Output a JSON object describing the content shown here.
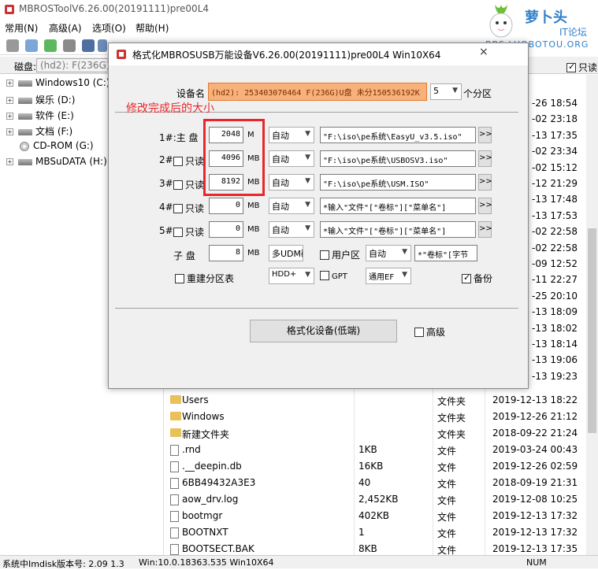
{
  "app": {
    "title": "MBROSToolV6.26.00(20191111)pre00L4",
    "menus": [
      "常用(N)",
      "高级(A)",
      "选项(O)",
      "帮助(H)"
    ],
    "disk_label": "磁盘:",
    "disk_value": "(hd2): F(236G)USB",
    "readonly_label": "只读"
  },
  "logo": {
    "brand": "萝卜头",
    "sub": "IT论坛",
    "url": "BBS.LUOBOTOU.ORG"
  },
  "tree": [
    {
      "label": "Windows10 (C:)",
      "type": "drive"
    },
    {
      "label": "娱乐 (D:)",
      "type": "drive"
    },
    {
      "label": "软件 (E:)",
      "type": "drive"
    },
    {
      "label": "文档 (F:)",
      "type": "drive"
    },
    {
      "label": "CD-ROM (G:)",
      "type": "cdrom"
    },
    {
      "label": "MBSuDATA (H:)",
      "type": "drive"
    }
  ],
  "file_dates_visible": [
    "-26 18:54",
    "-02 23:18",
    "-13 17:35",
    "-02 23:34",
    "-02 15:12",
    "-12 21:29",
    "-13 17:48",
    "-13 17:53",
    "-02 22:58",
    "-02 22:58",
    "-09 12:52",
    "-11 22:27",
    "-25 20:10",
    "-13 18:09",
    "-13 18:02",
    "-13 18:14",
    "-13 19:06",
    "-13 19:23"
  ],
  "files": [
    {
      "name": "Users",
      "size": "",
      "type": "文件夹",
      "date": "2019-12-13 18:22",
      "icon": "folder"
    },
    {
      "name": "Windows",
      "size": "",
      "type": "文件夹",
      "date": "2019-12-26 21:12",
      "icon": "folder"
    },
    {
      "name": "新建文件夹",
      "size": "",
      "type": "文件夹",
      "date": "2018-09-22 21:24",
      "icon": "folder"
    },
    {
      "name": ".rnd",
      "size": "1KB",
      "type": "文件",
      "date": "2019-03-24 00:43",
      "icon": "file"
    },
    {
      "name": ".__deepin.db",
      "size": "16KB",
      "type": "文件",
      "date": "2019-12-26 02:59",
      "icon": "file"
    },
    {
      "name": "6BB49432A3E3",
      "size": "40",
      "type": "文件",
      "date": "2018-09-19 21:31",
      "icon": "file"
    },
    {
      "name": "aow_drv.log",
      "size": "2,452KB",
      "type": "文件",
      "date": "2019-12-08 10:25",
      "icon": "file"
    },
    {
      "name": "bootmgr",
      "size": "402KB",
      "type": "文件",
      "date": "2019-12-13 17:32",
      "icon": "file"
    },
    {
      "name": "BOOTNXT",
      "size": "1",
      "type": "文件",
      "date": "2019-12-13 17:32",
      "icon": "file"
    },
    {
      "name": "BOOTSECT.BAK",
      "size": "8KB",
      "type": "文件",
      "date": "2019-12-13 17:35",
      "icon": "file"
    }
  ],
  "status": {
    "left": "系统中Imdisk版本号: 2.09 1.3",
    "mid": "Win:10.0.18363.535 Win10X64",
    "right": "NUM"
  },
  "dialog": {
    "title": "格式化MBROSUSB万能设备V6.26.00(20191111)pre00L4 Win10X64",
    "close": "×",
    "device_label": "设备名",
    "device_value": "(hd2): 253403070464 F(236G)U盘 未分150536192K",
    "partitions_count": "5",
    "partitions_label": "个分区",
    "annotation": "修改完成后的大小",
    "rows": [
      {
        "label": "1#:主  盘",
        "has_check": false,
        "size": "2048",
        "unit": "M",
        "fs": "自动",
        "path": "\"F:\\iso\\pe系统\\EasyU_v3.5.iso\""
      },
      {
        "label": "2#:",
        "has_check": true,
        "check_label": "只读",
        "size": "4096",
        "unit": "MB",
        "fs": "自动",
        "path": "\"F:\\iso\\pe系统\\USBOSV3.iso\""
      },
      {
        "label": "3#:",
        "has_check": true,
        "check_label": "只读",
        "size": "8192",
        "unit": "MB",
        "fs": "自动",
        "path": "\"F:\\iso\\pe系统\\USM.ISO\""
      },
      {
        "label": "4#:",
        "has_check": true,
        "check_label": "只读",
        "size": "0",
        "unit": "MB",
        "fs": "自动",
        "path": "*输入\"文件\"[\"卷标\"][\"菜单名\"]"
      },
      {
        "label": "5#:",
        "has_check": true,
        "check_label": "只读",
        "size": "0",
        "unit": "MB",
        "fs": "自动",
        "path": "*输入\"文件\"[\"卷标\"][\"菜单名\"]"
      }
    ],
    "sub_label": "子  盘",
    "sub_size": "8",
    "sub_unit": "MB",
    "sub_fs": "多UDM磁",
    "user_area_label": "用户区",
    "user_area_fs": "自动",
    "volume_label_value": "*\"卷标\"[字节",
    "rebuild_label": "重建分区表",
    "hdd_value": "HDD+",
    "gpt_label": "GPT",
    "efi_value": "通用EF",
    "backup_label": "备份",
    "format_button": "格式化设备(低端)",
    "advanced_label": "高级"
  }
}
